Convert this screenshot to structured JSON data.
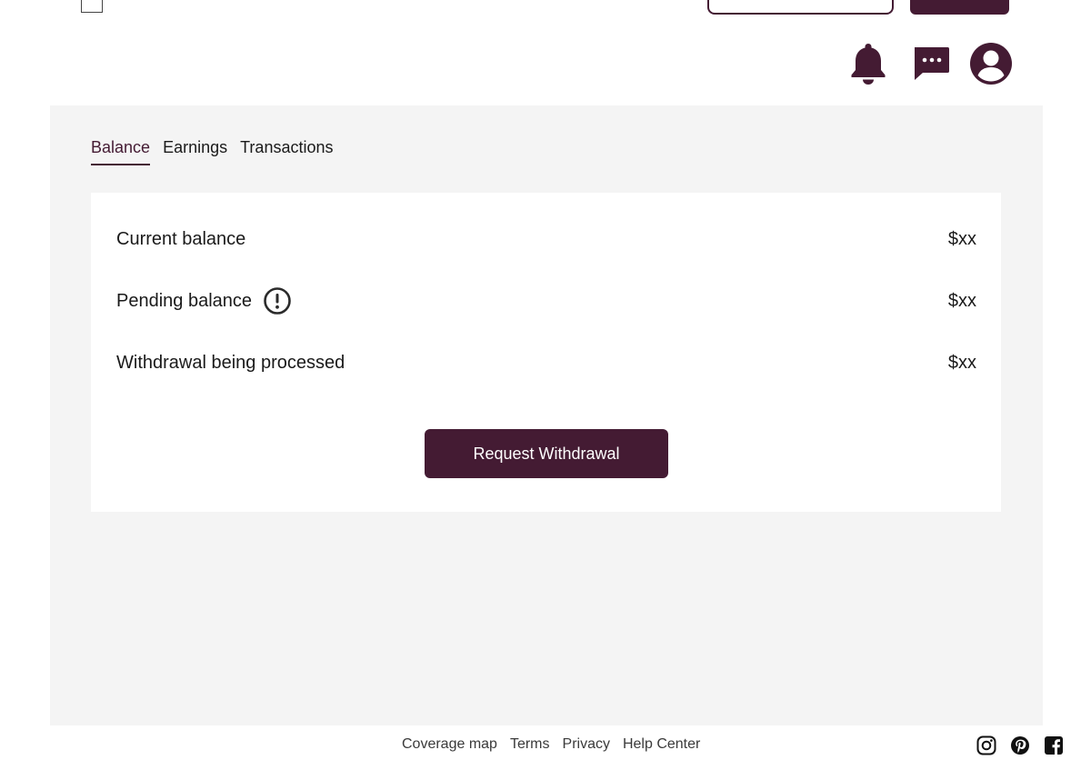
{
  "header": {
    "icons": {
      "notifications": "bell-icon",
      "messages": "chat-icon",
      "profile": "user-icon"
    }
  },
  "tabs": [
    {
      "label": "Balance",
      "active": true
    },
    {
      "label": "Earnings",
      "active": false
    },
    {
      "label": "Transactions",
      "active": false
    }
  ],
  "balance": {
    "rows": [
      {
        "label": "Current balance",
        "value": "$xx"
      },
      {
        "label": "Pending balance",
        "value": "$xx",
        "icon": "info-icon"
      },
      {
        "label": "Withdrawal being processed",
        "value": "$xx"
      }
    ],
    "button_label": "Request Withdrawal"
  },
  "footer": {
    "links": [
      "Coverage map",
      "Terms",
      "Privacy",
      "Help Center"
    ],
    "social": [
      "instagram-icon",
      "pinterest-icon",
      "facebook-icon"
    ]
  },
  "colors": {
    "brand": "#441b33",
    "panel_bg": "#f4f4f4",
    "card_bg": "#ffffff"
  }
}
